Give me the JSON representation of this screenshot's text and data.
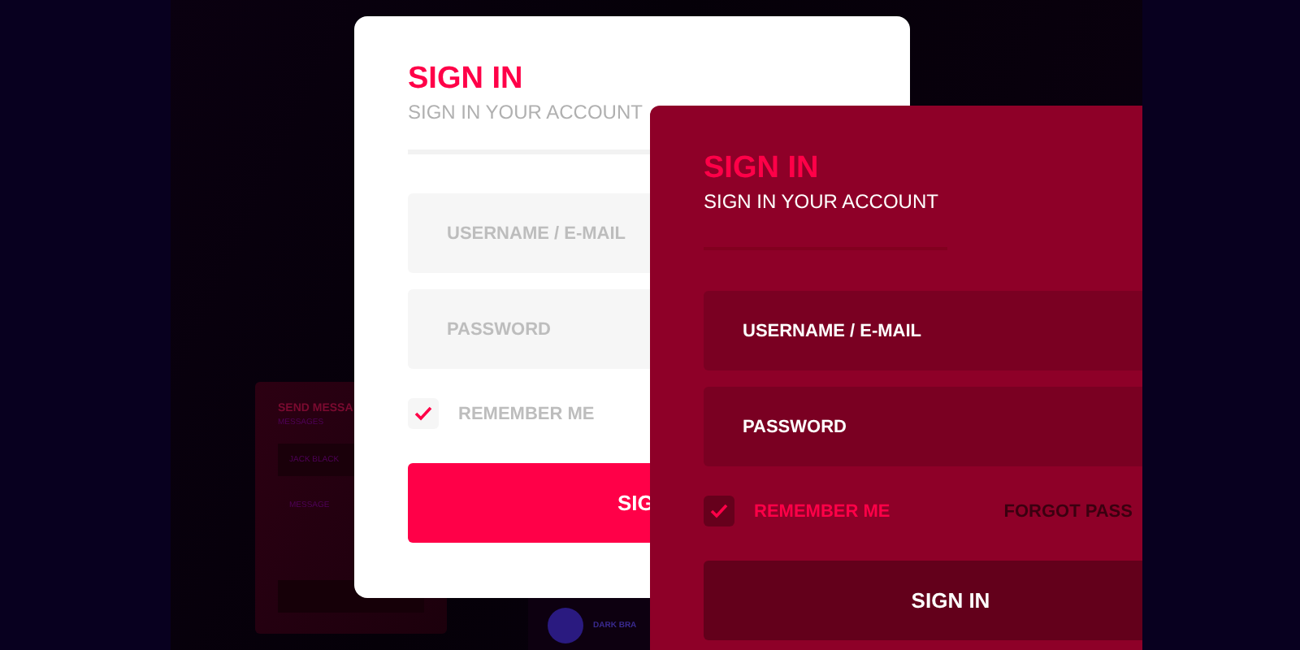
{
  "background_card": {
    "title": "SEND MESSA",
    "subtitle": "MESSAGES",
    "fields": [
      "JACK BLACK",
      "MESSAGE"
    ]
  },
  "badge": {
    "text": "DARK BRA"
  },
  "cards": [
    {
      "kind": "light",
      "title": "SIGN IN",
      "subtitle": "SIGN IN YOUR ACCOUNT",
      "fields": [
        {
          "placeholder": "USERNAME / E-MAIL"
        },
        {
          "placeholder": "PASSWORD"
        }
      ],
      "remember": {
        "label": "REMEMBER ME",
        "checked": true
      },
      "button": "SIG"
    },
    {
      "kind": "dark",
      "title": "SIGN IN",
      "subtitle": "SIGN IN YOUR ACCOUNT",
      "fields": [
        {
          "placeholder": "USERNAME / E-MAIL"
        },
        {
          "placeholder": "PASSWORD"
        }
      ],
      "remember": {
        "label": "REMEMBER ME",
        "checked": true
      },
      "forgot": "FORGOT PASS",
      "button": "SIGN IN"
    }
  ]
}
